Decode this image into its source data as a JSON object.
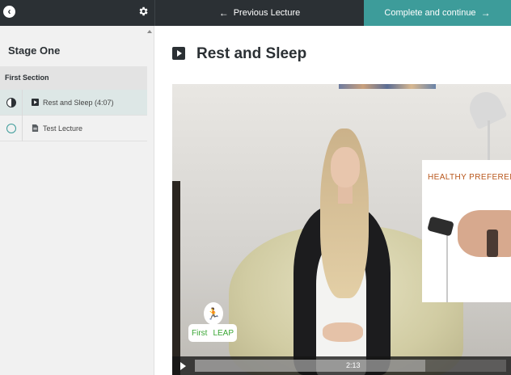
{
  "topbar": {
    "back_icon": "chevron-left-icon",
    "settings_icon": "gear-icon",
    "previous_label": "Previous Lecture",
    "complete_label": "Complete and continue"
  },
  "sidebar": {
    "stage_title": "Stage One",
    "section_title": "First Section",
    "lectures": [
      {
        "label": "Rest and Sleep (4:07)",
        "type_icon": "video-icon",
        "status": "in-progress",
        "active": true
      },
      {
        "label": "Test Lecture",
        "type_icon": "document-icon",
        "status": "not-started",
        "active": false
      }
    ]
  },
  "main": {
    "lecture_title": "Rest and Sleep"
  },
  "video": {
    "overlay_text": "HEALTHY PREFERENC",
    "logo_word1": "First",
    "logo_word2": "LEAP",
    "time": "2:13",
    "progress": 0.53,
    "buffered": 0.74
  },
  "colors": {
    "topbar_bg": "#2b3034",
    "accent": "#3d9c9a",
    "sidebar_bg": "#f1f1f1"
  }
}
